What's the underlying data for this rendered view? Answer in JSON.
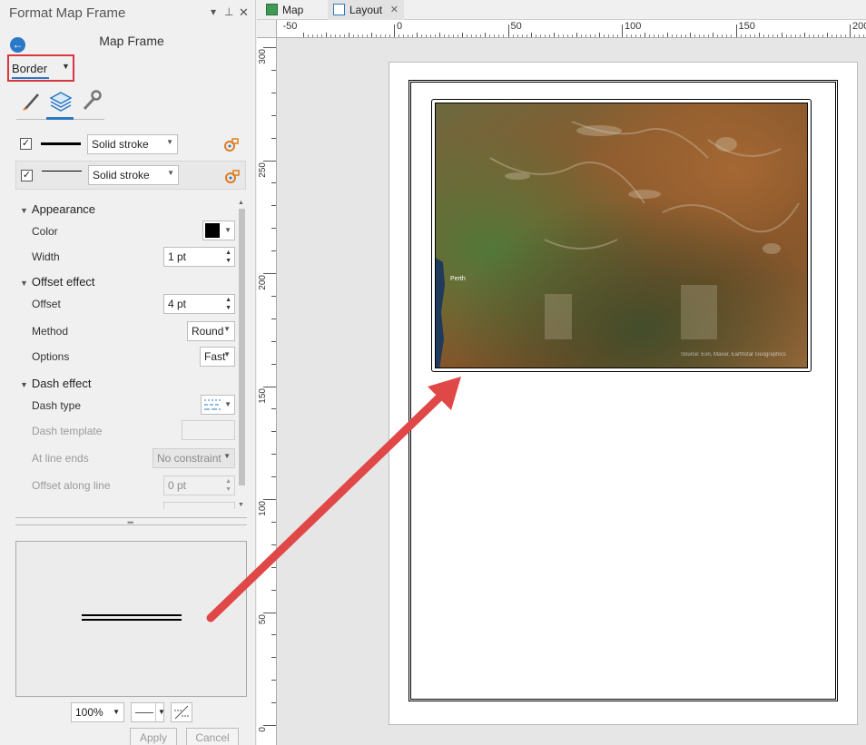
{
  "pane": {
    "title": "Format Map Frame",
    "element_name": "Map Frame",
    "mode_dropdown": "Border",
    "tabs": [
      {
        "icon": "paintbrush-icon",
        "active": false
      },
      {
        "icon": "layers-icon",
        "active": true
      },
      {
        "icon": "wrench-icon",
        "active": false
      }
    ],
    "strokes": [
      {
        "checked": true,
        "type": "Solid stroke"
      },
      {
        "checked": true,
        "type": "Solid stroke"
      }
    ],
    "appearance": {
      "heading": "Appearance",
      "color_label": "Color",
      "color_value": "#000000",
      "width_label": "Width",
      "width_value": "1 pt"
    },
    "offset_effect": {
      "heading": "Offset effect",
      "offset_label": "Offset",
      "offset_value": "4 pt",
      "method_label": "Method",
      "method_value": "Round",
      "options_label": "Options",
      "options_value": "Fast"
    },
    "dash_effect": {
      "heading": "Dash effect",
      "dash_type_label": "Dash type",
      "dash_template_label": "Dash template",
      "line_ends_label": "At line ends",
      "line_ends_value": "No constraint",
      "offset_along_label": "Offset along line",
      "offset_along_value": "0 pt"
    },
    "zoom_value": "100%",
    "apply_label": "Apply",
    "cancel_label": "Cancel"
  },
  "document_tabs": [
    {
      "label": "Map",
      "icon": "map-icon",
      "active": false
    },
    {
      "label": "Layout",
      "icon": "layout-icon",
      "active": true
    }
  ],
  "ruler": {
    "horizontal_labels": [
      "-50",
      "0",
      "50",
      "100",
      "150",
      "200"
    ],
    "vertical_labels": [
      "300",
      "250",
      "200",
      "150",
      "100",
      "50",
      "0"
    ]
  },
  "map": {
    "place_label": "Perth",
    "attribution": "Source: Esri, Maxar, Earthstar Geographics"
  },
  "colors": {
    "accent": "#2a78c6",
    "highlight_box": "#d9363e",
    "annotation_arrow": "#e04848"
  }
}
